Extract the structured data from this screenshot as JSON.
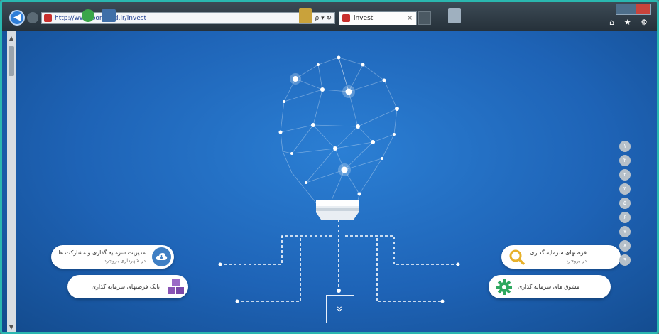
{
  "browser": {
    "url": "http://www.borujerd.ir/invest",
    "address_tools": "ρ ▾ ↻",
    "tab_title": "invest",
    "tab_close": "×",
    "toolbar_icons": "⌂ ★ ⚙"
  },
  "page": {
    "left_cards": [
      {
        "title": "مدیریت سرمایه گذاری و مشارکت ها",
        "subtitle": "در شهرداری بروجرد",
        "icon": "cloud-download-icon"
      },
      {
        "title": "بانک فرصتهای سرمایه گذاری",
        "subtitle": "",
        "icon": "cubes-icon"
      }
    ],
    "right_cards": [
      {
        "title": "فرصتهای سرمایه گذاری",
        "subtitle": "در بروجرد",
        "icon": "search-icon"
      },
      {
        "title": "مشوق های سرمایه گذاری",
        "subtitle": "",
        "icon": "gear-icon"
      }
    ],
    "nav_dots": [
      "۱",
      "۲",
      "۳",
      "۴",
      "۵",
      "۶",
      "۷",
      "۸",
      "۹"
    ],
    "scroll_down": "»"
  },
  "colors": {
    "background": "#1e63b6",
    "frame": "#2ab7b0",
    "card_icon": "#3f7fc4",
    "search_icon": "#e7b12b",
    "gear_icon": "#2fa860",
    "cubes_icon": "#8a55b5",
    "nav_dot": "#b6c0c9"
  }
}
